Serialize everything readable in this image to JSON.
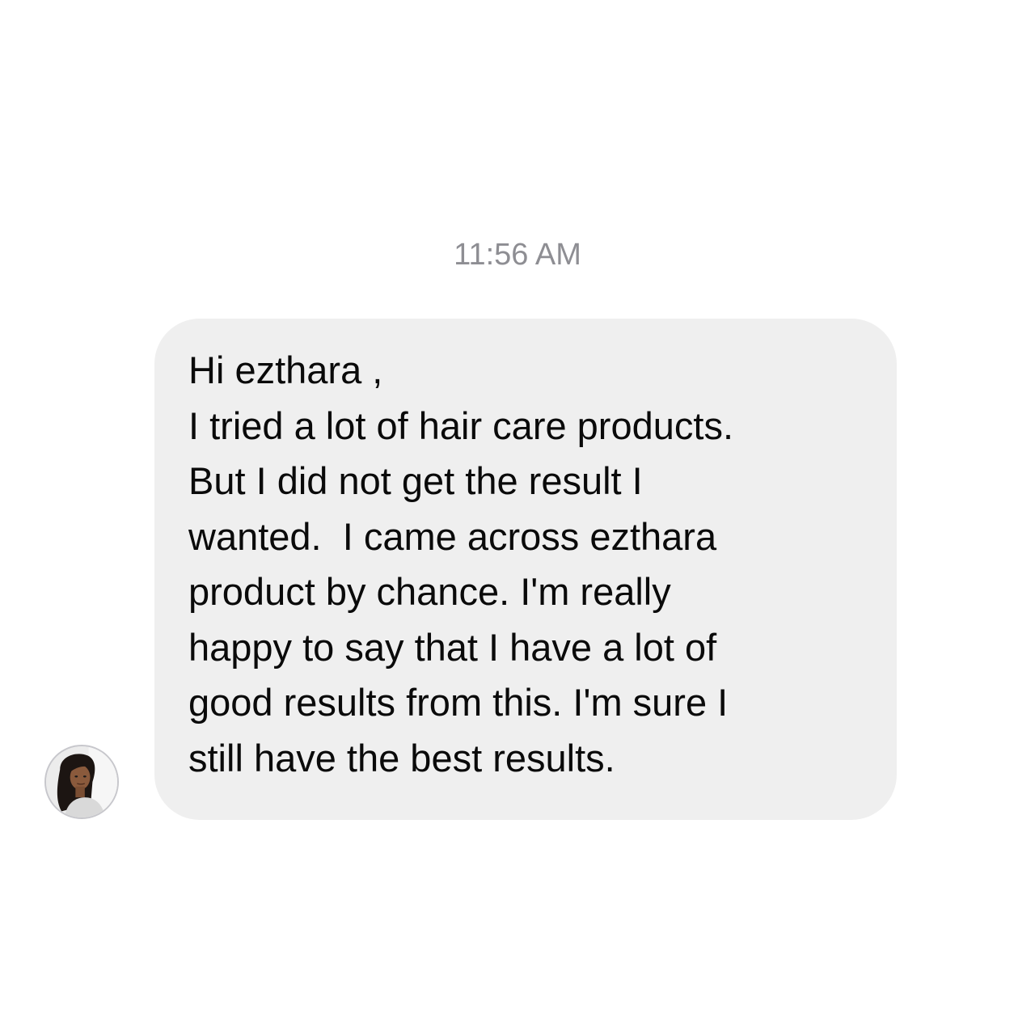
{
  "conversation": {
    "timestamp": "11:56 AM",
    "message": {
      "lines": [
        "Hi ezthara ,",
        "I tried a lot of hair care products.",
        "But I did not get the result I",
        "wanted.  I came across ezthara",
        "product by chance. I'm really",
        "happy to say that I have a lot of",
        "good results from this. I'm sure I",
        "still have the best results."
      ]
    },
    "sender_avatar_icon": "profile-photo"
  },
  "colors": {
    "bubble_background": "#efefef",
    "timestamp_text": "#8e8e93",
    "message_text": "#0a0a0a"
  }
}
